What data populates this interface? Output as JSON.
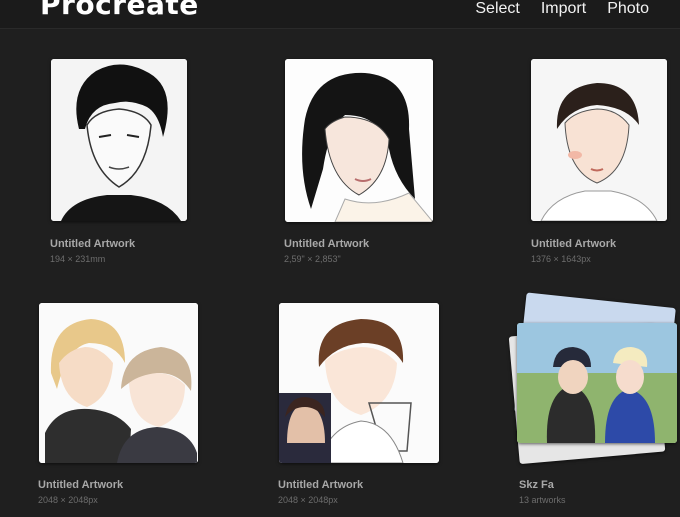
{
  "header": {
    "app_title": "Procreate",
    "actions": [
      "Select",
      "Import",
      "Photo"
    ]
  },
  "gallery": [
    {
      "title": "Untitled Artwork",
      "size": "194 × 231mm"
    },
    {
      "title": "Untitled Artwork",
      "size": "2,59\" × 2,853\""
    },
    {
      "title": "Untitled Artwork",
      "size": "1376 × 1643px"
    },
    {
      "title": "Untitled Artwork",
      "size": "2048 × 2048px"
    },
    {
      "title": "Untitled Artwork",
      "size": "2048 × 2048px"
    },
    {
      "title": "Skz Fa",
      "size": "13 artworks"
    }
  ],
  "colors": {
    "background": "#1f1f1f",
    "title_text": "#a8a8a8",
    "size_text": "#6d6d6d"
  }
}
